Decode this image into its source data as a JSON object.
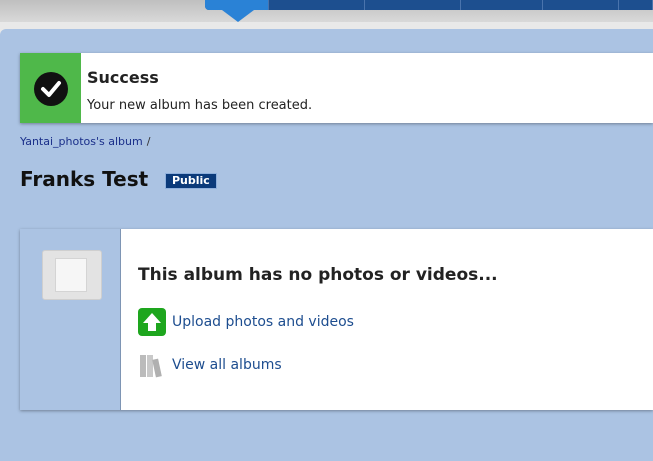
{
  "notice": {
    "title": "Success",
    "message": "Your new album has been created.",
    "icon": "checkmark-icon",
    "accent_color": "#4fb84a"
  },
  "breadcrumb": {
    "items": [
      "Yantai_photos's album"
    ],
    "separator": "/"
  },
  "album": {
    "title": "Franks Test",
    "visibility": "Public"
  },
  "empty_state": {
    "heading": "This album has no photos or videos...",
    "upload_label": "Upload photos and videos",
    "upload_icon": "upload-arrow-icon",
    "view_label": "View all albums",
    "view_icon": "books-icon"
  },
  "colors": {
    "nav": "#1d4f8f",
    "nav_active": "#2a82d6",
    "page_bg": "#abc3e3",
    "link": "#1d4d8f"
  }
}
